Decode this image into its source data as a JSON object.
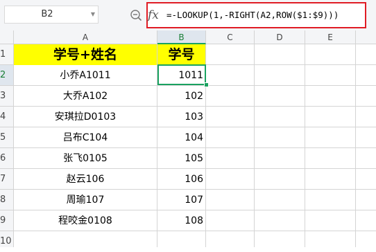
{
  "namebox": {
    "value": "B2"
  },
  "formula": {
    "text": "=-LOOKUP(1,-RIGHT(A2,ROW($1:$9)))"
  },
  "columns": [
    "A",
    "B",
    "C",
    "D",
    "E"
  ],
  "rows": [
    "1",
    "2",
    "3",
    "4",
    "5",
    "6",
    "7",
    "8",
    "9",
    "10"
  ],
  "table": {
    "header": {
      "a": "学号+姓名",
      "b": "学号"
    },
    "records": [
      {
        "a": "小乔A1011",
        "b": "1011"
      },
      {
        "a": "大乔A102",
        "b": "102"
      },
      {
        "a": "安琪拉D0103",
        "b": "103"
      },
      {
        "a": "吕布C104",
        "b": "104"
      },
      {
        "a": "张飞0105",
        "b": "105"
      },
      {
        "a": "赵云106",
        "b": "106"
      },
      {
        "a": "周瑜107",
        "b": "107"
      },
      {
        "a": "程咬金0108",
        "b": "108"
      }
    ]
  },
  "colors": {
    "highlight": "#ffff00",
    "selection": "#1aa260",
    "formula_border": "#e01b24"
  },
  "icons": {
    "fx": "fx",
    "zoom": "zoom-icon",
    "dropdown": "chevron-down-icon"
  }
}
